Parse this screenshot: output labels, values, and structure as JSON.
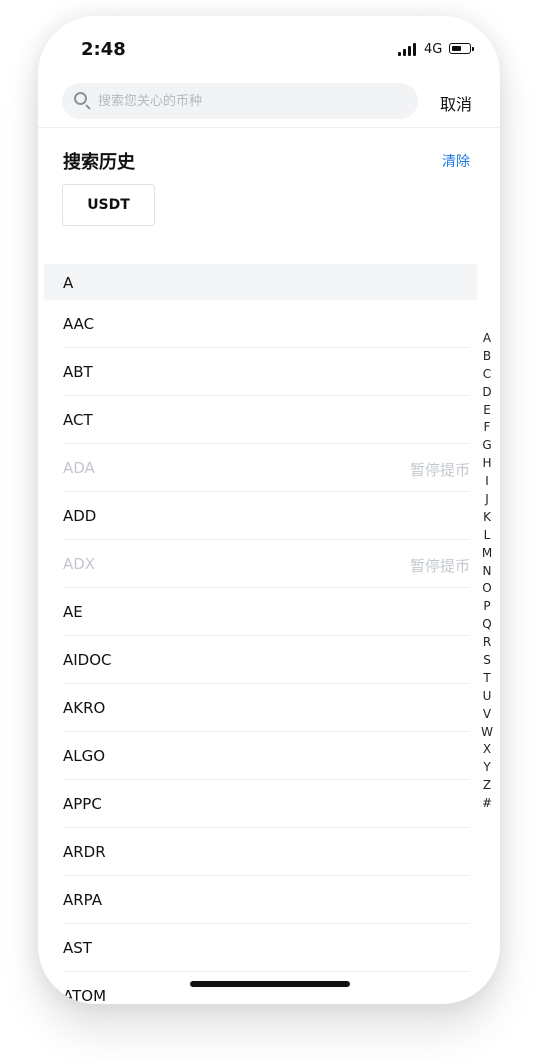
{
  "status_bar": {
    "time": "2:48",
    "network": "4G"
  },
  "search": {
    "placeholder": "搜索您关心的币种",
    "cancel_label": "取消"
  },
  "history": {
    "title": "搜索历史",
    "clear_label": "清除",
    "items": [
      "USDT"
    ]
  },
  "section": {
    "letter": "A"
  },
  "coins": [
    {
      "symbol": "AAC",
      "note": "",
      "disabled": false
    },
    {
      "symbol": "ABT",
      "note": "",
      "disabled": false
    },
    {
      "symbol": "ACT",
      "note": "",
      "disabled": false
    },
    {
      "symbol": "ADA",
      "note": "暂停提币",
      "disabled": true
    },
    {
      "symbol": "ADD",
      "note": "",
      "disabled": false
    },
    {
      "symbol": "ADX",
      "note": "暂停提币",
      "disabled": true
    },
    {
      "symbol": "AE",
      "note": "",
      "disabled": false
    },
    {
      "symbol": "AIDOC",
      "note": "",
      "disabled": false
    },
    {
      "symbol": "AKRO",
      "note": "",
      "disabled": false
    },
    {
      "symbol": "ALGO",
      "note": "",
      "disabled": false
    },
    {
      "symbol": "APPC",
      "note": "",
      "disabled": false
    },
    {
      "symbol": "ARDR",
      "note": "",
      "disabled": false
    },
    {
      "symbol": "ARPA",
      "note": "",
      "disabled": false
    },
    {
      "symbol": "AST",
      "note": "",
      "disabled": false
    },
    {
      "symbol": "ATOM",
      "note": "",
      "disabled": false
    }
  ],
  "alphabet_index": [
    "A",
    "B",
    "C",
    "D",
    "E",
    "F",
    "G",
    "H",
    "I",
    "J",
    "K",
    "L",
    "M",
    "N",
    "O",
    "P",
    "Q",
    "R",
    "S",
    "T",
    "U",
    "V",
    "W",
    "X",
    "Y",
    "Z",
    "#"
  ]
}
